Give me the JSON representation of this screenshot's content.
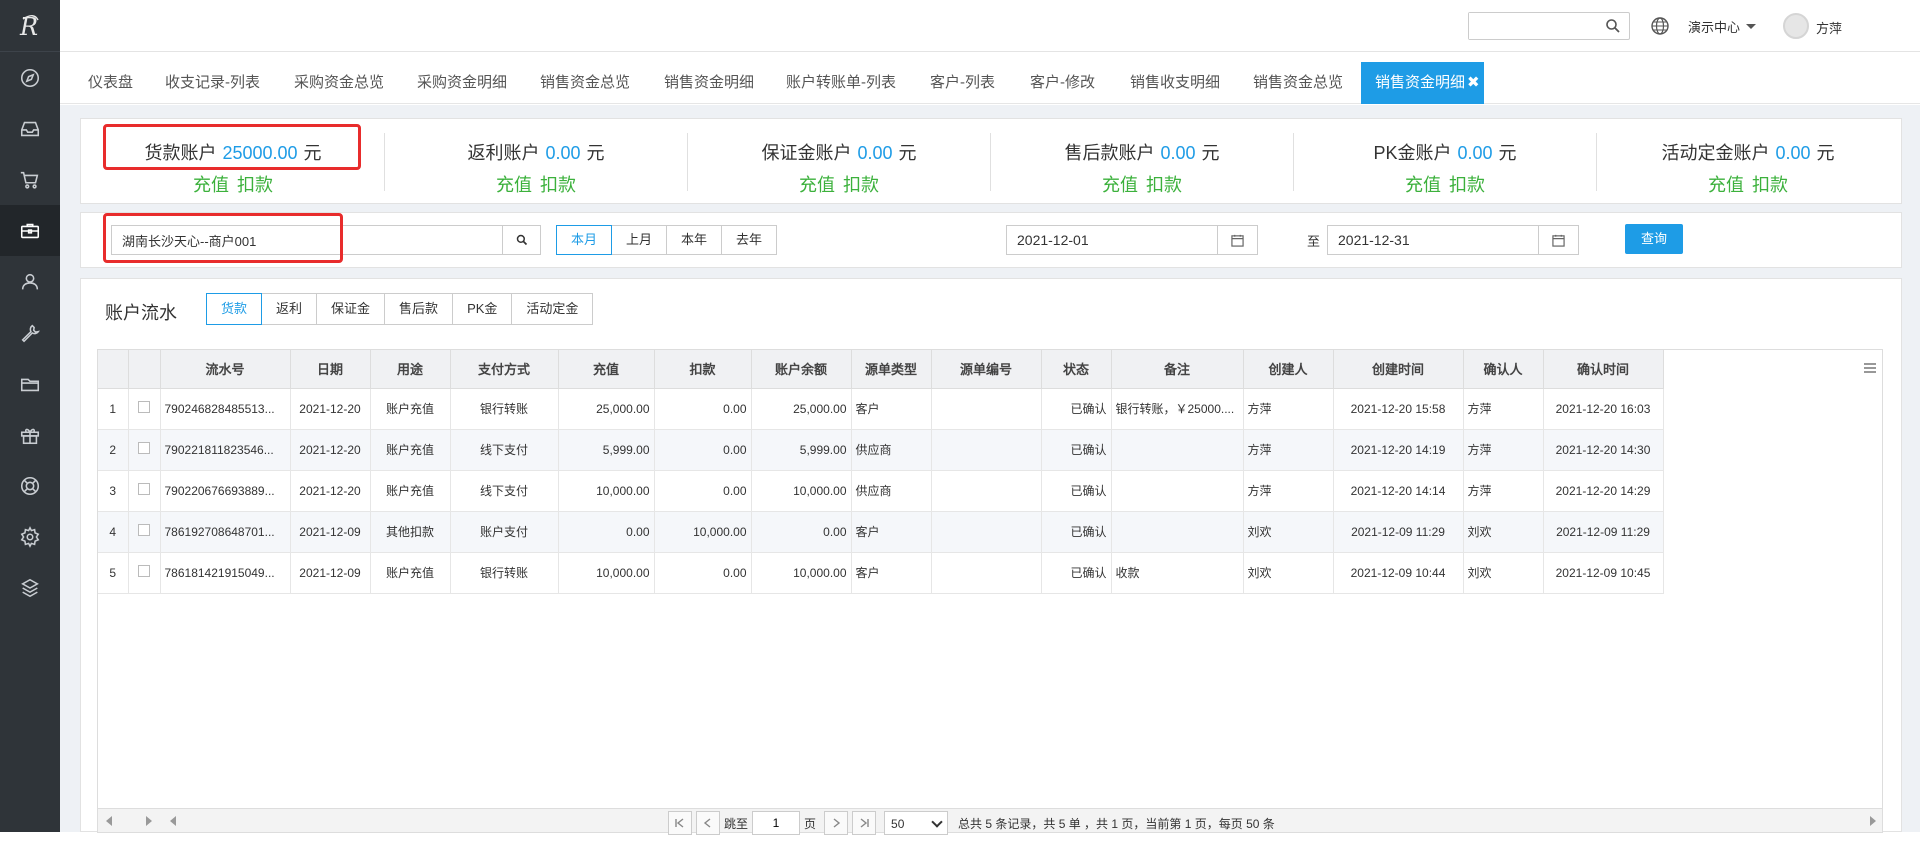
{
  "header": {
    "search_placeholder": "",
    "demo_center": "演示中心",
    "username": "方萍"
  },
  "tabs": [
    {
      "label": "仪表盘"
    },
    {
      "label": "收支记录-列表"
    },
    {
      "label": "采购资金总览"
    },
    {
      "label": "采购资金明细"
    },
    {
      "label": "销售资金总览"
    },
    {
      "label": "销售资金明细"
    },
    {
      "label": "账户转账单-列表"
    },
    {
      "label": "客户-列表"
    },
    {
      "label": "客户-修改"
    },
    {
      "label": "销售收支明细"
    },
    {
      "label": "销售资金总览"
    },
    {
      "label": "销售资金明细",
      "active": true
    }
  ],
  "accounts": [
    {
      "name": "货款账户",
      "value": "25000.00",
      "unit": "元",
      "recharge": "充值",
      "deduct": "扣款"
    },
    {
      "name": "返利账户",
      "value": "0.00",
      "unit": "元",
      "recharge": "充值",
      "deduct": "扣款"
    },
    {
      "name": "保证金账户",
      "value": "0.00",
      "unit": "元",
      "recharge": "充值",
      "deduct": "扣款"
    },
    {
      "name": "售后款账户",
      "value": "0.00",
      "unit": "元",
      "recharge": "充值",
      "deduct": "扣款"
    },
    {
      "name": "PK金账户",
      "value": "0.00",
      "unit": "元",
      "recharge": "充值",
      "deduct": "扣款"
    },
    {
      "name": "活动定金账户",
      "value": "0.00",
      "unit": "元",
      "recharge": "充值",
      "deduct": "扣款"
    }
  ],
  "filter": {
    "merchant": "湖南长沙天心--商户001",
    "periods": [
      "本月",
      "上月",
      "本年",
      "去年"
    ],
    "active_period": "本月",
    "date_from": "2021-12-01",
    "date_to": "2021-12-31",
    "to_label": "至",
    "query_label": "查询"
  },
  "flow": {
    "title": "账户流水",
    "types": [
      "货款",
      "返利",
      "保证金",
      "售后款",
      "PK金",
      "活动定金"
    ],
    "active_type": "货款",
    "columns": [
      "",
      "",
      "流水号",
      "日期",
      "用途",
      "支付方式",
      "充值",
      "扣款",
      "账户余额",
      "源单类型",
      "源单编号",
      "状态",
      "备注",
      "创建人",
      "创建时间",
      "确认人",
      "确认时间"
    ],
    "rows": [
      {
        "no": "1",
        "serial": "790246828485513...",
        "date": "2021-12-20",
        "usage": "账户充值",
        "pay": "银行转账",
        "recharge": "25,000.00",
        "deduct": "0.00",
        "balance": "25,000.00",
        "src_type": "客户",
        "src_no": "",
        "status": "已确认",
        "remark": "银行转账，￥25000....",
        "creator": "方萍",
        "created": "2021-12-20 15:58",
        "confirmer": "方萍",
        "confirmed": "2021-12-20 16:03"
      },
      {
        "no": "2",
        "serial": "790221811823546...",
        "date": "2021-12-20",
        "usage": "账户充值",
        "pay": "线下支付",
        "recharge": "5,999.00",
        "deduct": "0.00",
        "balance": "5,999.00",
        "src_type": "供应商",
        "src_no": "",
        "status": "已确认",
        "remark": "",
        "creator": "方萍",
        "created": "2021-12-20 14:19",
        "confirmer": "方萍",
        "confirmed": "2021-12-20 14:30"
      },
      {
        "no": "3",
        "serial": "790220676693889...",
        "date": "2021-12-20",
        "usage": "账户充值",
        "pay": "线下支付",
        "recharge": "10,000.00",
        "deduct": "0.00",
        "balance": "10,000.00",
        "src_type": "供应商",
        "src_no": "",
        "status": "已确认",
        "remark": "",
        "creator": "方萍",
        "created": "2021-12-20 14:14",
        "confirmer": "方萍",
        "confirmed": "2021-12-20 14:29"
      },
      {
        "no": "4",
        "serial": "786192708648701...",
        "date": "2021-12-09",
        "usage": "其他扣款",
        "pay": "账户支付",
        "recharge": "0.00",
        "deduct": "10,000.00",
        "balance": "0.00",
        "src_type": "客户",
        "src_no": "",
        "status": "已确认",
        "remark": "",
        "creator": "刘欢",
        "created": "2021-12-09 11:29",
        "confirmer": "刘欢",
        "confirmed": "2021-12-09 11:29"
      },
      {
        "no": "5",
        "serial": "786181421915049...",
        "date": "2021-12-09",
        "usage": "账户充值",
        "pay": "银行转账",
        "recharge": "10,000.00",
        "deduct": "0.00",
        "balance": "10,000.00",
        "src_type": "客户",
        "src_no": "",
        "status": "已确认",
        "remark": "收款",
        "creator": "刘欢",
        "created": "2021-12-09 10:44",
        "confirmer": "刘欢",
        "confirmed": "2021-12-09 10:45"
      }
    ]
  },
  "pager": {
    "jump_label": "跳至",
    "page_value": "1",
    "page_label": "页",
    "page_size": "50",
    "summary": "总共 5 条记录，共 5 单 ，共 1 页，当前第 1 页，每页 50 条"
  }
}
